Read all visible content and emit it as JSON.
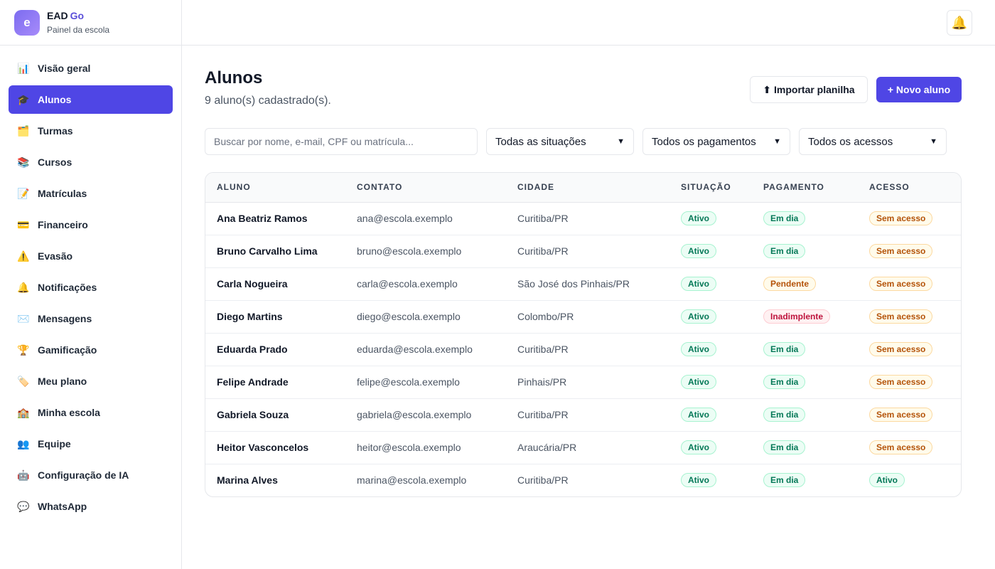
{
  "brand": {
    "logo_letter": "e",
    "name_main": "EAD",
    "name_accent": "Go",
    "subtitle": "Painel da escola"
  },
  "colors": {
    "accent": "#4f46e5",
    "green": "#047857",
    "amber": "#b45309",
    "red": "#be123c"
  },
  "sidebar": {
    "items": [
      {
        "icon": "📊",
        "label": "Visão geral"
      },
      {
        "icon": "🎓",
        "label": "Alunos"
      },
      {
        "icon": "🗂️",
        "label": "Turmas"
      },
      {
        "icon": "📚",
        "label": "Cursos"
      },
      {
        "icon": "📝",
        "label": "Matrículas"
      },
      {
        "icon": "💳",
        "label": "Financeiro"
      },
      {
        "icon": "⚠️",
        "label": "Evasão"
      },
      {
        "icon": "🔔",
        "label": "Notificações"
      },
      {
        "icon": "✉️",
        "label": "Mensagens"
      },
      {
        "icon": "🏆",
        "label": "Gamificação"
      },
      {
        "icon": "🏷️",
        "label": "Meu plano"
      },
      {
        "icon": "🏫",
        "label": "Minha escola"
      },
      {
        "icon": "👥",
        "label": "Equipe"
      },
      {
        "icon": "🤖",
        "label": "Configuração de IA"
      },
      {
        "icon": "💬",
        "label": "WhatsApp"
      }
    ],
    "active_index": 1
  },
  "topbar": {
    "bell_icon": "🔔"
  },
  "page": {
    "title": "Alunos",
    "subtitle": "9 aluno(s) cadastrado(s).",
    "import_label": "⬆ Importar planilha",
    "new_label": "+ Novo aluno"
  },
  "filters": {
    "search_placeholder": "Buscar por nome, e-mail, CPF ou matrícula...",
    "situacao": "Todas as situações",
    "pagamento": "Todos os pagamentos",
    "acesso": "Todos os acessos"
  },
  "table": {
    "headers": [
      "ALUNO",
      "CONTATO",
      "CIDADE",
      "SITUAÇÃO",
      "PAGAMENTO",
      "ACESSO"
    ],
    "rows": [
      {
        "aluno": "Ana Beatriz Ramos",
        "contato": "ana@escola.exemplo",
        "cidade": "Curitiba/PR",
        "situacao": "Ativo",
        "pagamento": "Em dia",
        "acesso": "Sem acesso"
      },
      {
        "aluno": "Bruno Carvalho Lima",
        "contato": "bruno@escola.exemplo",
        "cidade": "Curitiba/PR",
        "situacao": "Ativo",
        "pagamento": "Em dia",
        "acesso": "Sem acesso"
      },
      {
        "aluno": "Carla Nogueira",
        "contato": "carla@escola.exemplo",
        "cidade": "São José dos Pinhais/PR",
        "situacao": "Ativo",
        "pagamento": "Pendente",
        "acesso": "Sem acesso"
      },
      {
        "aluno": "Diego Martins",
        "contato": "diego@escola.exemplo",
        "cidade": "Colombo/PR",
        "situacao": "Ativo",
        "pagamento": "Inadimplente",
        "acesso": "Sem acesso"
      },
      {
        "aluno": "Eduarda Prado",
        "contato": "eduarda@escola.exemplo",
        "cidade": "Curitiba/PR",
        "situacao": "Ativo",
        "pagamento": "Em dia",
        "acesso": "Sem acesso"
      },
      {
        "aluno": "Felipe Andrade",
        "contato": "felipe@escola.exemplo",
        "cidade": "Pinhais/PR",
        "situacao": "Ativo",
        "pagamento": "Em dia",
        "acesso": "Sem acesso"
      },
      {
        "aluno": "Gabriela Souza",
        "contato": "gabriela@escola.exemplo",
        "cidade": "Curitiba/PR",
        "situacao": "Ativo",
        "pagamento": "Em dia",
        "acesso": "Sem acesso"
      },
      {
        "aluno": "Heitor Vasconcelos",
        "contato": "heitor@escola.exemplo",
        "cidade": "Araucária/PR",
        "situacao": "Ativo",
        "pagamento": "Em dia",
        "acesso": "Sem acesso"
      },
      {
        "aluno": "Marina Alves",
        "contato": "marina@escola.exemplo",
        "cidade": "Curitiba/PR",
        "situacao": "Ativo",
        "pagamento": "Em dia",
        "acesso": "Ativo"
      }
    ]
  }
}
